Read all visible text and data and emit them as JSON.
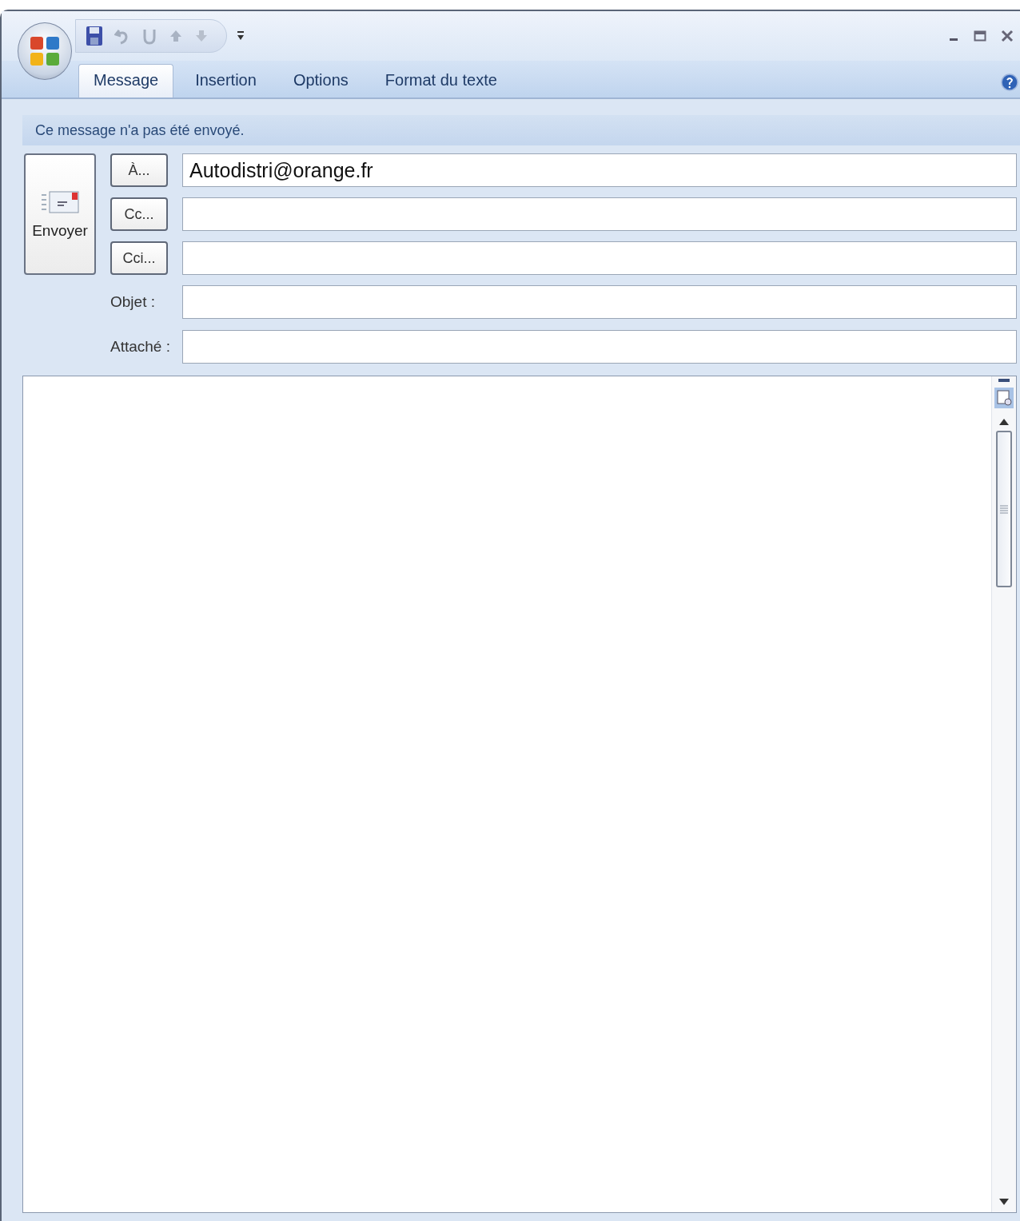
{
  "tabs": [
    {
      "label": "Message",
      "selected": true
    },
    {
      "label": "Insertion",
      "selected": false
    },
    {
      "label": "Options",
      "selected": false
    },
    {
      "label": "Format du texte",
      "selected": false
    }
  ],
  "info_bar": {
    "text": "Ce message n'a pas été envoyé."
  },
  "send_button": {
    "label": "Envoyer"
  },
  "recipients": [
    {
      "button": "À...",
      "value": "Autodistri@orange.fr"
    },
    {
      "button": "Cc..."
    },
    {
      "button": "Cci..."
    }
  ],
  "fields": [
    {
      "label": "Objet :"
    },
    {
      "label": "Attaché :"
    }
  ]
}
